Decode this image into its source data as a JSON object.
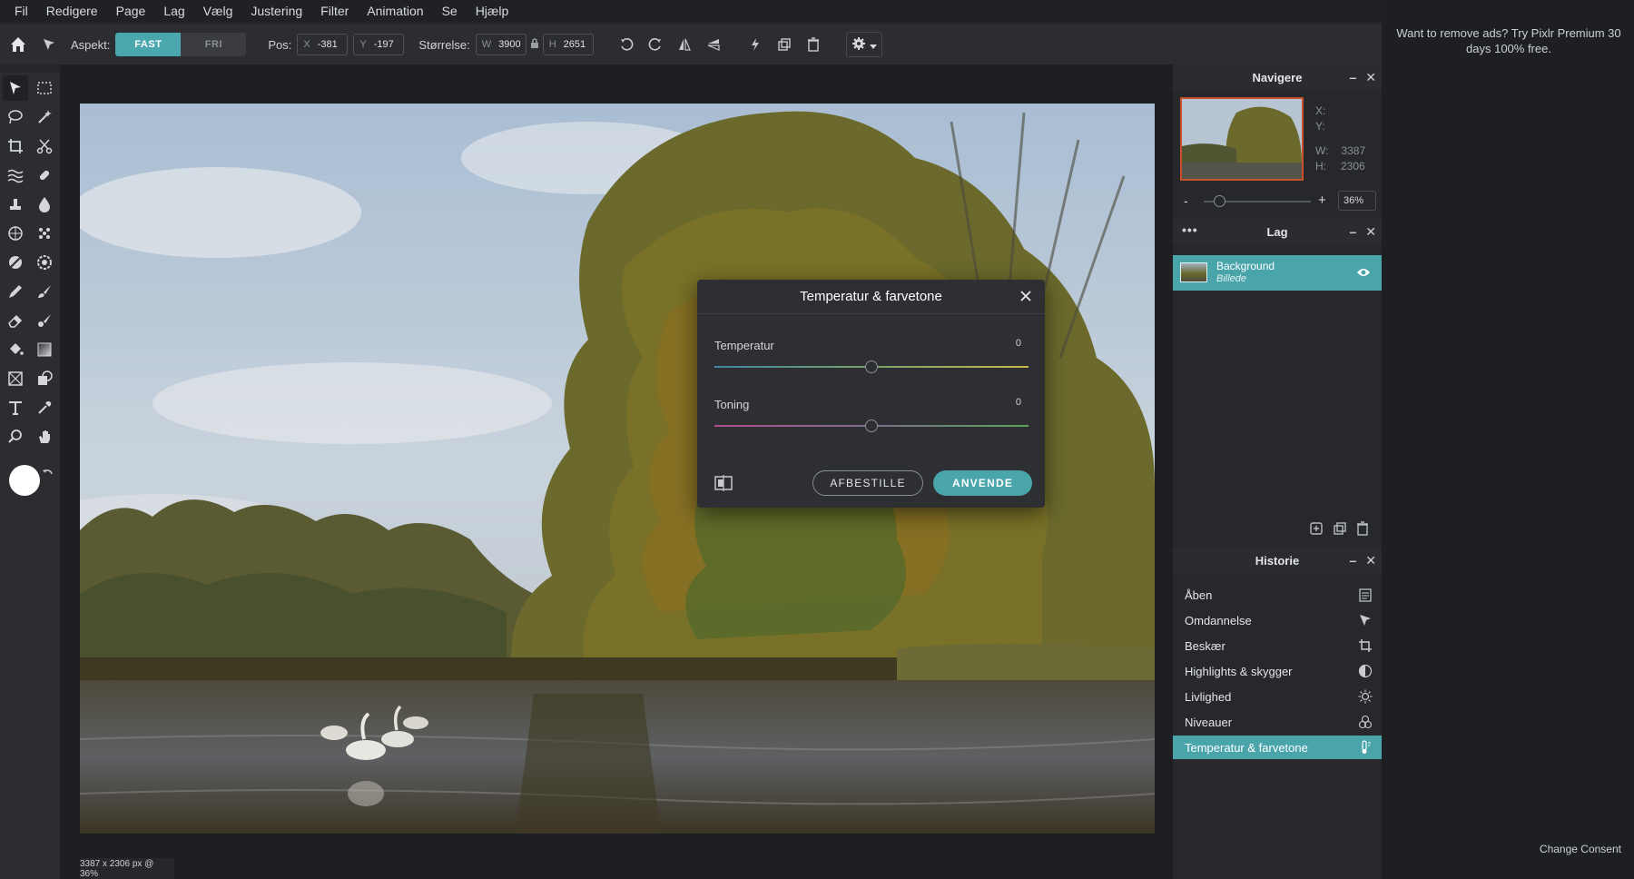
{
  "menu": [
    "Fil",
    "Redigere",
    "Page",
    "Lag",
    "Vælg",
    "Justering",
    "Filter",
    "Animation",
    "Se",
    "Hjælp"
  ],
  "toolbar": {
    "aspect_label": "Aspekt:",
    "aspect_fixed": "FAST",
    "aspect_free": "FRI",
    "pos_label": "Pos:",
    "x_key": "X",
    "x_value": "-381",
    "y_key": "Y",
    "y_value": "-197",
    "size_label": "Størrelse:",
    "w_key": "W",
    "w_value": "3900",
    "h_key": "H",
    "h_value": "2651"
  },
  "dialog": {
    "title": "Temperatur & farvetone",
    "sliders": [
      {
        "label": "Temperatur",
        "value": "0"
      },
      {
        "label": "Toning",
        "value": "0"
      }
    ],
    "cancel": "AFBESTILLE",
    "apply": "ANVENDE"
  },
  "navigator": {
    "title": "Navigere",
    "x_label": "X:",
    "y_label": "Y:",
    "w_label": "W:",
    "w_value": "3387",
    "h_label": "H:",
    "h_value": "2306",
    "zoom_minus": "-",
    "zoom_plus": "+",
    "zoom_value": "36%",
    "zoom_level": 0.36
  },
  "layers": {
    "title": "Lag",
    "items": [
      {
        "name": "Background",
        "type": "Billede"
      }
    ]
  },
  "history": {
    "title": "Historie",
    "items": [
      "Åben",
      "Omdannelse",
      "Beskær",
      "Highlights & skygger",
      "Livlighed",
      "Niveauer",
      "Temperatur & farvetone"
    ]
  },
  "status": "3387 x 2306 px @ 36%",
  "ad": {
    "text": "Want to remove ads? Try Pixlr Premium 30 days 100% free.",
    "consent": "Change Consent"
  },
  "colors": {
    "accent": "#4aa5ab",
    "foreground": "#ffffff",
    "background": "#000000"
  }
}
